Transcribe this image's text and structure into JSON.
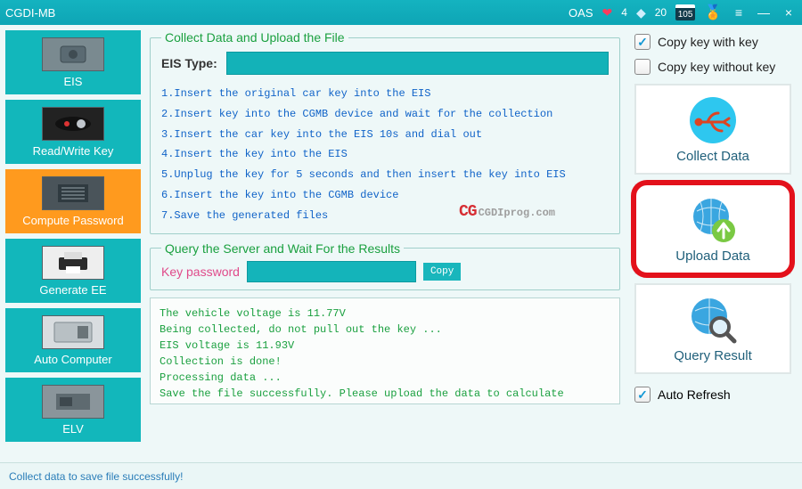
{
  "titlebar": {
    "title": "CGDI-MB",
    "oas_label": "OAS",
    "hearts": "4",
    "diamonds": "20",
    "calendar": "105"
  },
  "sidebar": {
    "items": [
      {
        "label": "EIS"
      },
      {
        "label": "Read/Write Key"
      },
      {
        "label": "Compute Password"
      },
      {
        "label": "Generate EE"
      },
      {
        "label": "Auto Computer"
      },
      {
        "label": "ELV"
      }
    ]
  },
  "collect_panel": {
    "legend": "Collect Data and Upload the File",
    "eis_type_label": "EIS Type:",
    "eis_type_value": "",
    "steps": [
      "1.Insert the original car key into the EIS",
      "2.Insert key into the CGMB device and wait for the collection",
      "3.Insert the car key into the EIS 10s and dial out",
      "4.Insert the key into the EIS",
      "5.Unplug the key for 5 seconds and then insert the key into EIS",
      "6.Insert the key into the CGMB device",
      "7.Save the generated files"
    ],
    "watermark_cg": "CG",
    "watermark_txt": "CGDIprog.com"
  },
  "query_panel": {
    "legend": "Query the Server and Wait For the Results",
    "key_password_label": "Key password",
    "key_password_value": "",
    "copy_label": "Copy"
  },
  "log": {
    "lines": [
      "The vehicle voltage is 11.77V",
      "Being collected, do not pull out the key ...",
      "EIS voltage is 11.93V",
      "Collection is done!",
      "Processing data ...",
      "Save the file successfully. Please upload the data to calculate PASSWORD"
    ]
  },
  "right": {
    "copy_with_key": "Copy key with key",
    "copy_without_key": "Copy key without key",
    "collect_data": "Collect Data",
    "upload_data": "Upload  Data",
    "query_result": "Query Result",
    "auto_refresh": "Auto Refresh"
  },
  "statusbar": {
    "text": "Collect data to save file successfully!"
  }
}
